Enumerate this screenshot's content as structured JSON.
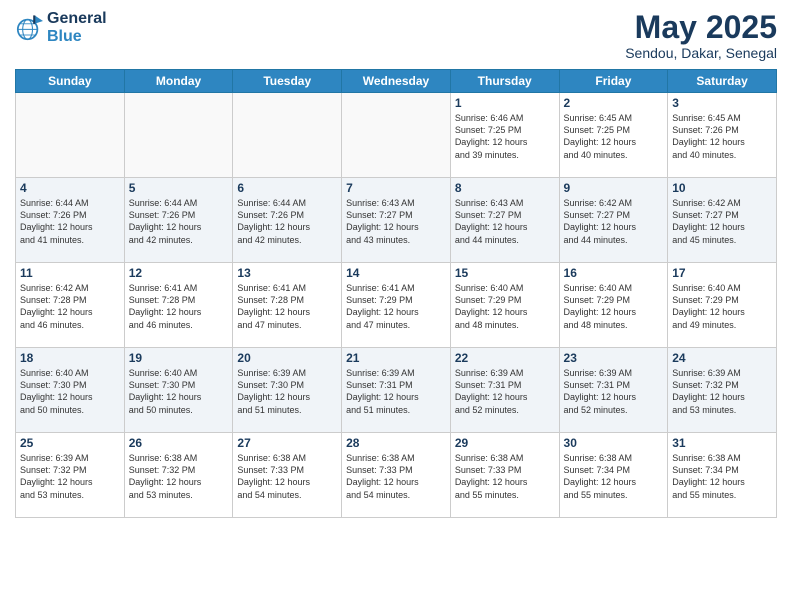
{
  "logo": {
    "line1": "General",
    "line2": "Blue"
  },
  "title": "May 2025",
  "location": "Sendou, Dakar, Senegal",
  "days_of_week": [
    "Sunday",
    "Monday",
    "Tuesday",
    "Wednesday",
    "Thursday",
    "Friday",
    "Saturday"
  ],
  "weeks": [
    [
      {
        "day": "",
        "info": ""
      },
      {
        "day": "",
        "info": ""
      },
      {
        "day": "",
        "info": ""
      },
      {
        "day": "",
        "info": ""
      },
      {
        "day": "1",
        "info": "Sunrise: 6:46 AM\nSunset: 7:25 PM\nDaylight: 12 hours\nand 39 minutes."
      },
      {
        "day": "2",
        "info": "Sunrise: 6:45 AM\nSunset: 7:25 PM\nDaylight: 12 hours\nand 40 minutes."
      },
      {
        "day": "3",
        "info": "Sunrise: 6:45 AM\nSunset: 7:26 PM\nDaylight: 12 hours\nand 40 minutes."
      }
    ],
    [
      {
        "day": "4",
        "info": "Sunrise: 6:44 AM\nSunset: 7:26 PM\nDaylight: 12 hours\nand 41 minutes."
      },
      {
        "day": "5",
        "info": "Sunrise: 6:44 AM\nSunset: 7:26 PM\nDaylight: 12 hours\nand 42 minutes."
      },
      {
        "day": "6",
        "info": "Sunrise: 6:44 AM\nSunset: 7:26 PM\nDaylight: 12 hours\nand 42 minutes."
      },
      {
        "day": "7",
        "info": "Sunrise: 6:43 AM\nSunset: 7:27 PM\nDaylight: 12 hours\nand 43 minutes."
      },
      {
        "day": "8",
        "info": "Sunrise: 6:43 AM\nSunset: 7:27 PM\nDaylight: 12 hours\nand 44 minutes."
      },
      {
        "day": "9",
        "info": "Sunrise: 6:42 AM\nSunset: 7:27 PM\nDaylight: 12 hours\nand 44 minutes."
      },
      {
        "day": "10",
        "info": "Sunrise: 6:42 AM\nSunset: 7:27 PM\nDaylight: 12 hours\nand 45 minutes."
      }
    ],
    [
      {
        "day": "11",
        "info": "Sunrise: 6:42 AM\nSunset: 7:28 PM\nDaylight: 12 hours\nand 46 minutes."
      },
      {
        "day": "12",
        "info": "Sunrise: 6:41 AM\nSunset: 7:28 PM\nDaylight: 12 hours\nand 46 minutes."
      },
      {
        "day": "13",
        "info": "Sunrise: 6:41 AM\nSunset: 7:28 PM\nDaylight: 12 hours\nand 47 minutes."
      },
      {
        "day": "14",
        "info": "Sunrise: 6:41 AM\nSunset: 7:29 PM\nDaylight: 12 hours\nand 47 minutes."
      },
      {
        "day": "15",
        "info": "Sunrise: 6:40 AM\nSunset: 7:29 PM\nDaylight: 12 hours\nand 48 minutes."
      },
      {
        "day": "16",
        "info": "Sunrise: 6:40 AM\nSunset: 7:29 PM\nDaylight: 12 hours\nand 48 minutes."
      },
      {
        "day": "17",
        "info": "Sunrise: 6:40 AM\nSunset: 7:29 PM\nDaylight: 12 hours\nand 49 minutes."
      }
    ],
    [
      {
        "day": "18",
        "info": "Sunrise: 6:40 AM\nSunset: 7:30 PM\nDaylight: 12 hours\nand 50 minutes."
      },
      {
        "day": "19",
        "info": "Sunrise: 6:40 AM\nSunset: 7:30 PM\nDaylight: 12 hours\nand 50 minutes."
      },
      {
        "day": "20",
        "info": "Sunrise: 6:39 AM\nSunset: 7:30 PM\nDaylight: 12 hours\nand 51 minutes."
      },
      {
        "day": "21",
        "info": "Sunrise: 6:39 AM\nSunset: 7:31 PM\nDaylight: 12 hours\nand 51 minutes."
      },
      {
        "day": "22",
        "info": "Sunrise: 6:39 AM\nSunset: 7:31 PM\nDaylight: 12 hours\nand 52 minutes."
      },
      {
        "day": "23",
        "info": "Sunrise: 6:39 AM\nSunset: 7:31 PM\nDaylight: 12 hours\nand 52 minutes."
      },
      {
        "day": "24",
        "info": "Sunrise: 6:39 AM\nSunset: 7:32 PM\nDaylight: 12 hours\nand 53 minutes."
      }
    ],
    [
      {
        "day": "25",
        "info": "Sunrise: 6:39 AM\nSunset: 7:32 PM\nDaylight: 12 hours\nand 53 minutes."
      },
      {
        "day": "26",
        "info": "Sunrise: 6:38 AM\nSunset: 7:32 PM\nDaylight: 12 hours\nand 53 minutes."
      },
      {
        "day": "27",
        "info": "Sunrise: 6:38 AM\nSunset: 7:33 PM\nDaylight: 12 hours\nand 54 minutes."
      },
      {
        "day": "28",
        "info": "Sunrise: 6:38 AM\nSunset: 7:33 PM\nDaylight: 12 hours\nand 54 minutes."
      },
      {
        "day": "29",
        "info": "Sunrise: 6:38 AM\nSunset: 7:33 PM\nDaylight: 12 hours\nand 55 minutes."
      },
      {
        "day": "30",
        "info": "Sunrise: 6:38 AM\nSunset: 7:34 PM\nDaylight: 12 hours\nand 55 minutes."
      },
      {
        "day": "31",
        "info": "Sunrise: 6:38 AM\nSunset: 7:34 PM\nDaylight: 12 hours\nand 55 minutes."
      }
    ]
  ]
}
